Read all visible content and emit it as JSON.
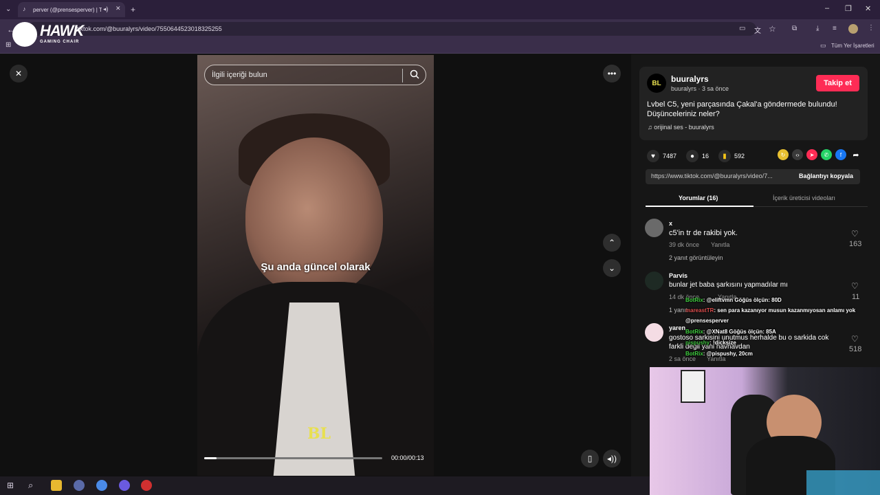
{
  "browser": {
    "tab_title": "perver (@prensesperver) | T",
    "url": "tiktok.com/@buuralyrs/video/7550644523018325255",
    "bookmarks_label": "Tüm Yer İşaretleri"
  },
  "overlay_logo": {
    "title": "HAWK",
    "subtitle": "GAMING CHAIR"
  },
  "player": {
    "search_placeholder": "İlgili içeriği bulun",
    "subtitle": "Şu anda güncel olarak",
    "watermark": "BL",
    "time": "00:00/00:13",
    "progress": 0.07
  },
  "post": {
    "avatar_text": "BL",
    "username": "buuralyrs",
    "meta": "buuralyrs · 3 sa önce",
    "follow_label": "Takip et",
    "description": "Lvbel C5, yeni parçasında Çakal'a göndermede bulundu! Düşünceleriniz neler?",
    "music": "orijinal ses - buuralyrs",
    "likes": "7487",
    "comments": "16",
    "saves": "592",
    "link": "https://www.tiktok.com/@buuralyrs/video/7...",
    "copy_label": "Bağlantıyı kopyala",
    "tab_comments": "Yorumlar (16)",
    "tab_creator": "İçerik üreticisi videoları"
  },
  "comments": [
    {
      "name": "x",
      "text": "c5'in tr de rakibi yok.",
      "time": "39 dk önce",
      "reply": "Yanıtla",
      "likes": "163",
      "replies": "2 yanıt görüntüleyin"
    },
    {
      "name": "Parvis",
      "text": "bunlar jet baba şarkısını yapmadılar mı",
      "time": "14 dk önce",
      "reply": "Yanıtla",
      "likes": "11",
      "replies": "1 yanıt"
    },
    {
      "name": "yaren",
      "text": "gostoso sarkisini unutmus herhalde bu o sarkida cok farkli degil yani havhavdan",
      "time": "2 sa önce",
      "reply": "Yanıtla",
      "likes": "518"
    }
  ],
  "chat": [
    {
      "user": "BotRix",
      "msg": ": @eliftvmn Göğüs ölçün: 80D"
    },
    {
      "user": "mareastTR",
      "msg": ": sen para kazanıyor musun kazanmıyosan anlamı yok"
    },
    {
      "user": "",
      "msg": "@prensesperver"
    },
    {
      "user": "BotRix",
      "msg": ": @XNat8 Göğüs ölçün: 85A"
    },
    {
      "user": "pispushy",
      "msg": ": !dicksize"
    },
    {
      "user": "BotRix",
      "msg": ": @pispushy, 20cm"
    }
  ],
  "colors": {
    "follow": "#fe2c55",
    "accent": "#e8e050"
  }
}
